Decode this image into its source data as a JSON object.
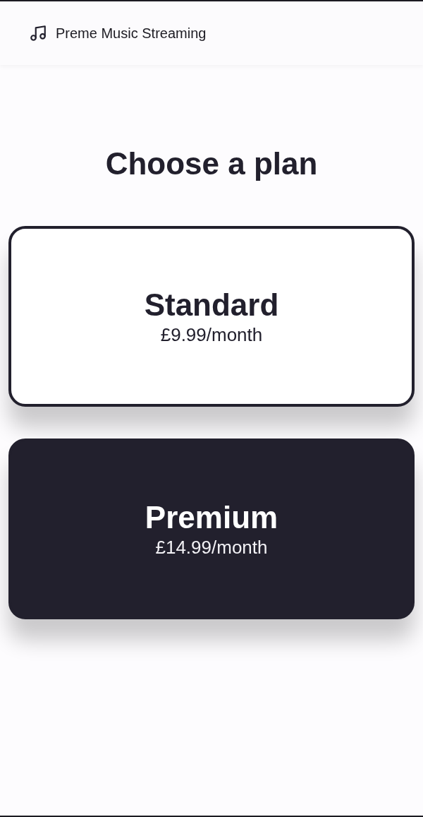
{
  "header": {
    "title": "Preme Music Streaming"
  },
  "heading": "Choose a plan",
  "plans": [
    {
      "name": "Standard",
      "price": "£9.99/month",
      "selected": false
    },
    {
      "name": "Premium",
      "price": "£14.99/month",
      "selected": true
    }
  ]
}
